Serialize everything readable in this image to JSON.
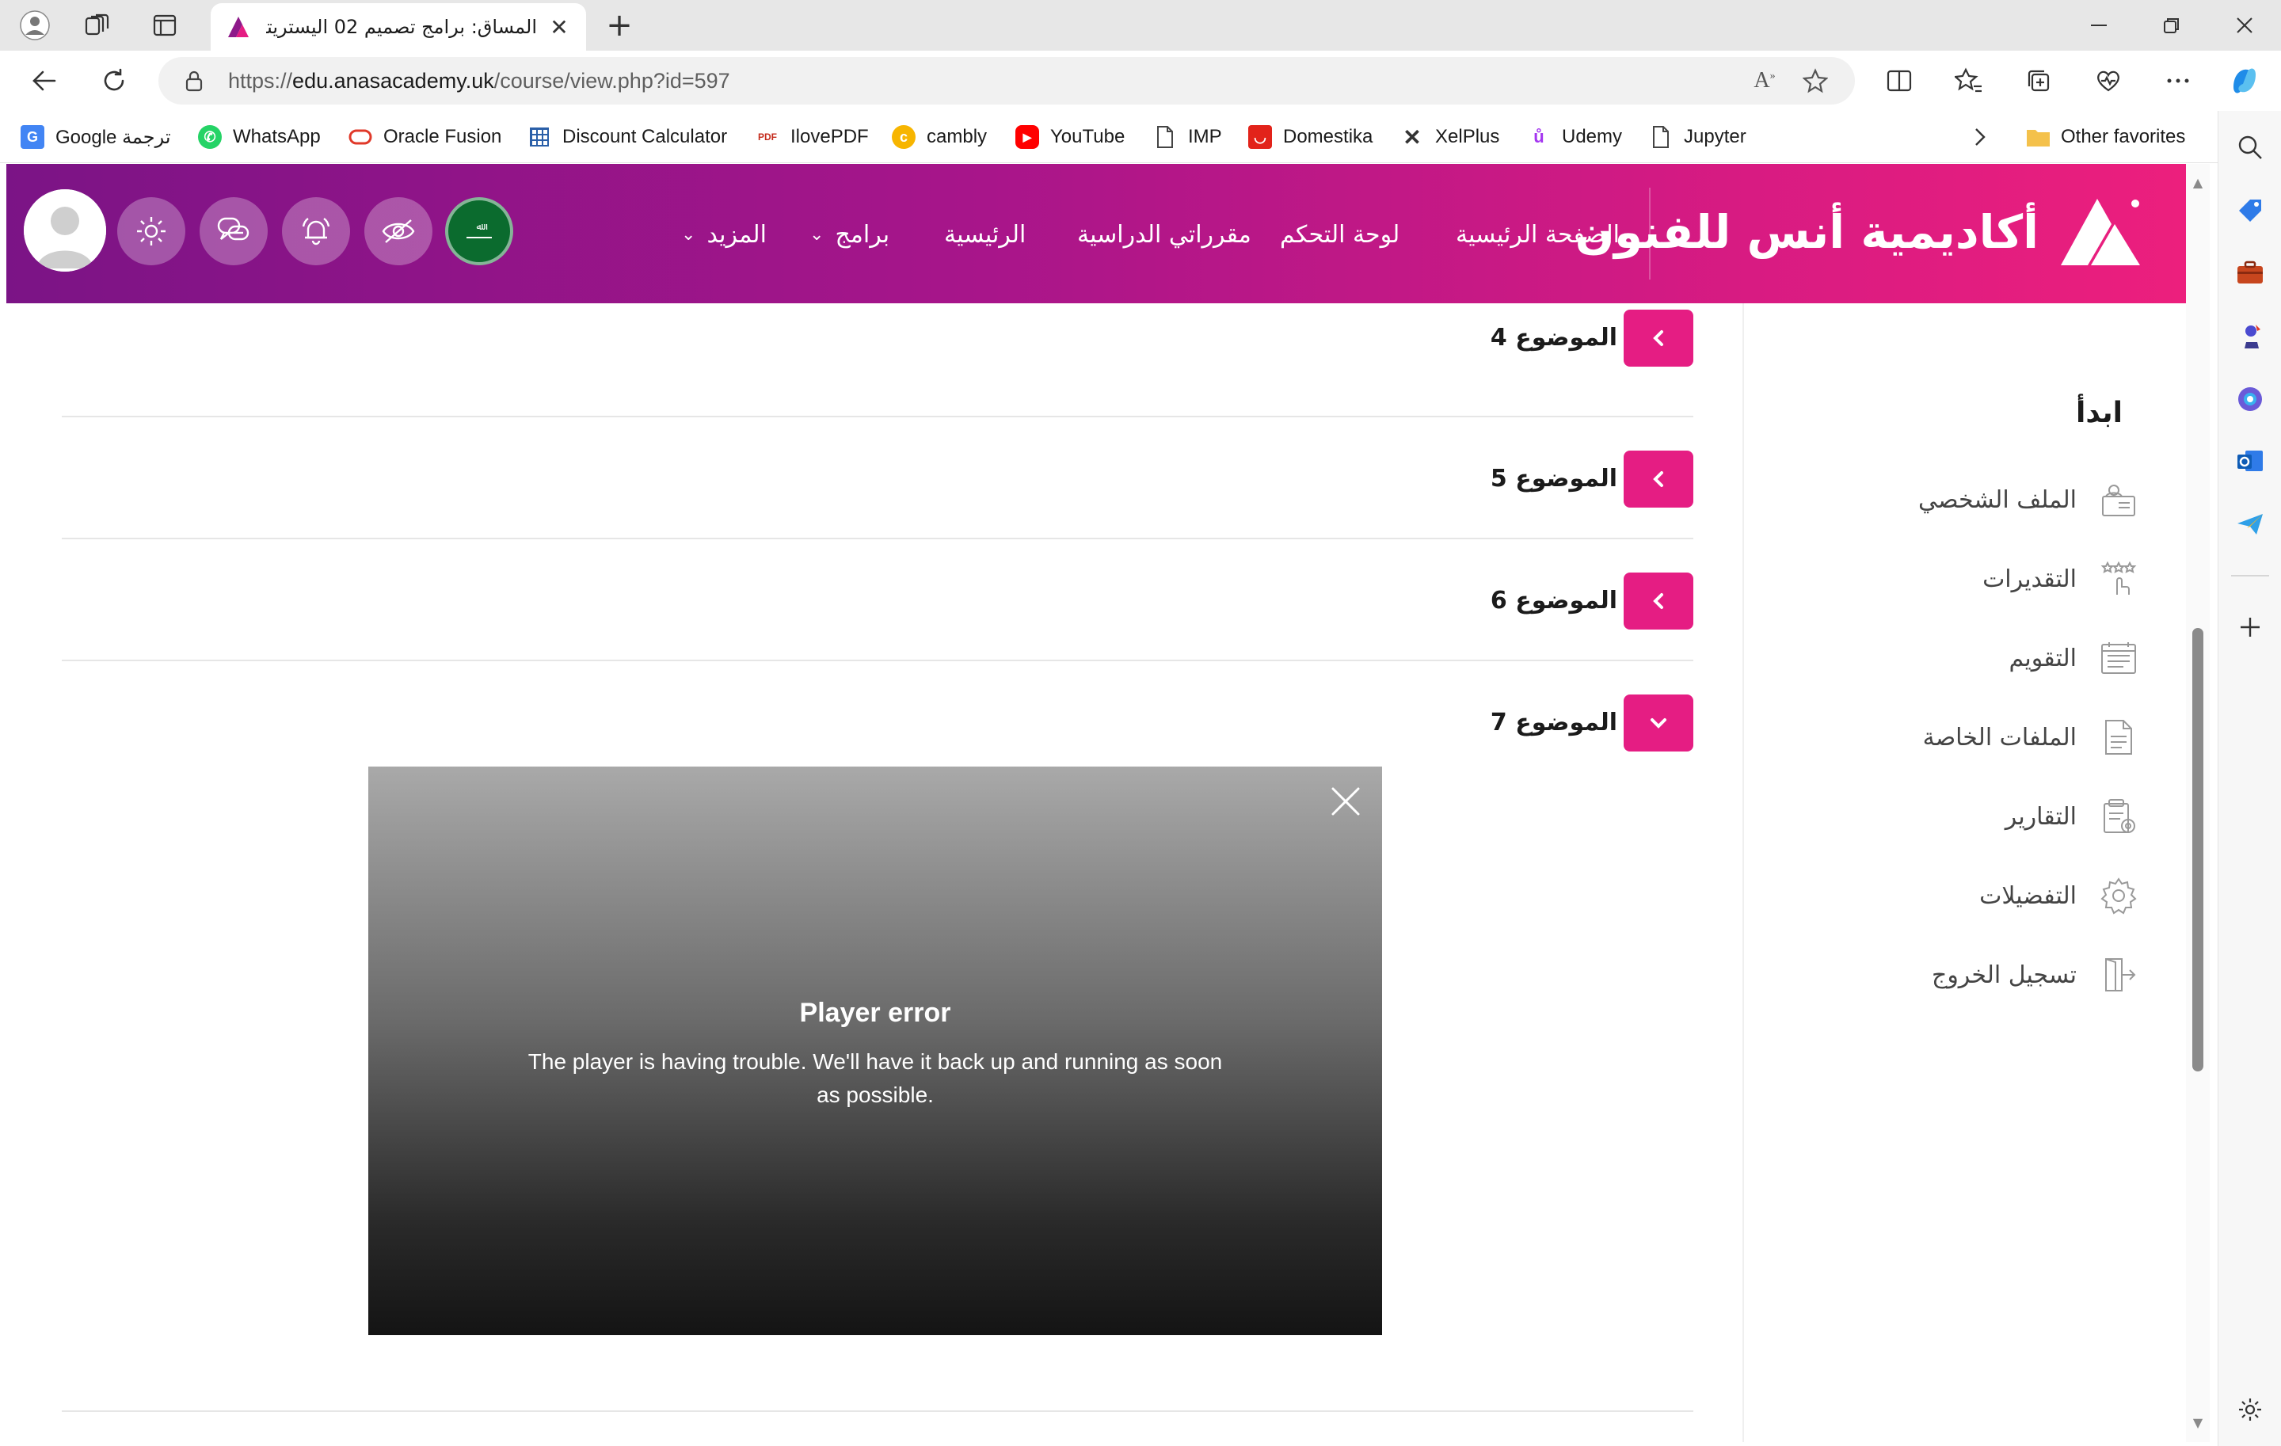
{
  "browser": {
    "tab_title": "المساق: برامج تصميم 02 اليستريتور",
    "url_prefix": "https://",
    "url_host": "edu.anasacademy.uk",
    "url_path": "/course/view.php?id=597",
    "favorites": [
      {
        "label": "Google ترجمة",
        "icon": "google-translate-icon",
        "color": "#4285f4"
      },
      {
        "label": "WhatsApp",
        "icon": "whatsapp-icon",
        "color": "#25d366"
      },
      {
        "label": "Oracle Fusion",
        "icon": "oracle-icon",
        "color": "#e0392a"
      },
      {
        "label": "Discount Calculator",
        "icon": "calculator-icon",
        "color": "#2a5fa8"
      },
      {
        "label": "IlovePDF",
        "icon": "pdf-icon",
        "color": "#c42b1c"
      },
      {
        "label": "cambly",
        "icon": "cambly-icon",
        "color": "#f7b500"
      },
      {
        "label": "YouTube",
        "icon": "youtube-icon",
        "color": "#ff0000"
      },
      {
        "label": "IMP",
        "icon": "page-icon",
        "color": "#555555"
      },
      {
        "label": "Domestika",
        "icon": "domestika-icon",
        "color": "#e2231a"
      },
      {
        "label": "XelPlus",
        "icon": "xelplus-icon",
        "color": "#333333"
      },
      {
        "label": "Udemy",
        "icon": "udemy-icon",
        "color": "#a435f0"
      },
      {
        "label": "Jupyter",
        "icon": "page-icon",
        "color": "#555555"
      }
    ],
    "other_favorites": "Other favorites"
  },
  "site": {
    "logo_text": "أكاديمية أنس للفنون",
    "nav": [
      {
        "label": "الصفحة الرئيسية",
        "dropdown": false
      },
      {
        "label": "لوحة التحكم",
        "dropdown": false
      },
      {
        "label": "مقرراتي الدراسية",
        "dropdown": false
      },
      {
        "label": "الرئيسية",
        "dropdown": false
      },
      {
        "label": "برامج",
        "dropdown": true
      },
      {
        "label": "المزيد",
        "dropdown": true
      }
    ],
    "brand_color": "#e51d83"
  },
  "topics": [
    {
      "label": "الموضوع 4",
      "expanded": false
    },
    {
      "label": "الموضوع 5",
      "expanded": false
    },
    {
      "label": "الموضوع 6",
      "expanded": false
    },
    {
      "label": "الموضوع 7",
      "expanded": true
    }
  ],
  "player": {
    "title": "Player error",
    "message": "The player is having trouble. We'll have it back up and running as soon as possible."
  },
  "drawer": {
    "heading": "ابدأ",
    "items": [
      {
        "label": "الملف الشخصي",
        "icon": "profile-icon"
      },
      {
        "label": "التقديرات",
        "icon": "grades-icon"
      },
      {
        "label": "التقويم",
        "icon": "calendar-icon"
      },
      {
        "label": "الملفات الخاصة",
        "icon": "file-icon"
      },
      {
        "label": "التقارير",
        "icon": "reports-icon"
      },
      {
        "label": "التفضيلات",
        "icon": "preferences-icon"
      },
      {
        "label": "تسجيل الخروج",
        "icon": "logout-icon"
      }
    ]
  }
}
